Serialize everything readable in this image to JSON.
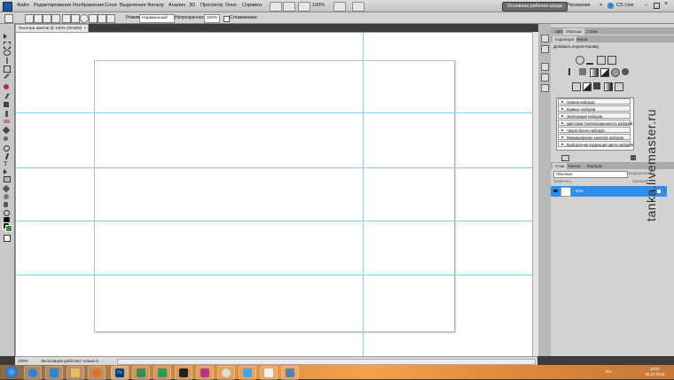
{
  "menubar": {
    "items": [
      "Файл",
      "Редактирование",
      "Изображение",
      "Слои",
      "Выделение",
      "Фильтр",
      "Анализ",
      "3D",
      "Просмотр",
      "Окно",
      "Справка"
    ],
    "zoom": "100%",
    "workspace_basic": "Основная рабочая среда",
    "workspace_drawing": "Рисование",
    "cs_live": "CS Live"
  },
  "options": {
    "mode_label": "Режим:",
    "mode_value": "Нормальный",
    "opacity_label": "Непрозрачность:",
    "opacity_value": "100%",
    "smoothing_label": "Сглаживание"
  },
  "document": {
    "tab_title": "Палитра цветов @ 100% (RGB/8)",
    "status_zoom": "100%",
    "status_text": "Экспозиция работает только в ..."
  },
  "panels": {
    "top_tabs": [
      "Цвет",
      "Образцы",
      "Стили"
    ],
    "adj_tabs": [
      "Коррекция",
      "Маски"
    ],
    "add_adjustment": "Добавить корректировку",
    "presets": [
      "Уровни наборов",
      "Кривые наборов",
      "Экспозиция наборов",
      "Цветовой тон/Насыщенность наборов",
      "Черно-белое наборов",
      "Микширование каналов наборов",
      "Выборочная коррекция цвета наборов"
    ],
    "layer_tabs": [
      "Слои",
      "Каналы",
      "Контуры"
    ],
    "blend_mode": "Обычные",
    "opacity_label": "Непрозрачность:",
    "fill_label": "Заливка:",
    "lock_label": "Закрепить:",
    "layer_name": "Фон"
  },
  "taskbar": {
    "language": "RU",
    "time": "18:00",
    "date": "06.07.2016"
  },
  "watermark": "tanka.livemaster.ru",
  "colors": {
    "guide": "#7fd8e6",
    "selected_layer": "#2f8fe8",
    "foreground_swatch": "#1a1a1a",
    "background_swatch": "#3d8f3d"
  }
}
